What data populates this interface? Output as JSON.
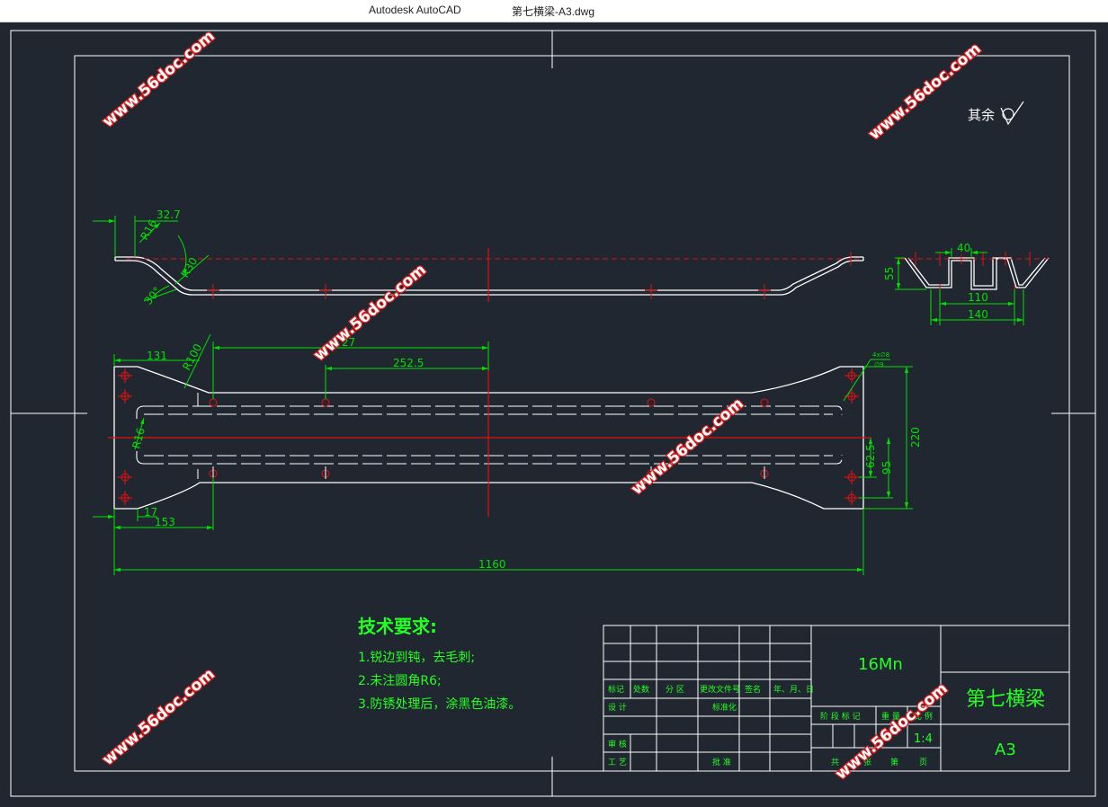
{
  "window": {
    "app_title": "Autodesk AutoCAD",
    "file_title": "第七横梁-A3.dwg"
  },
  "colors": {
    "background": "#212730",
    "drawing_lines": "#ffffff",
    "dimensions": "#00e000",
    "centerlines": "#e01010",
    "text": "#22ff22",
    "watermark": "#e02020"
  },
  "watermark": "www.56doc.com",
  "surface_note": "其余",
  "side_view_dims": {
    "d32_7": "32.7",
    "r16": "R16",
    "r30": "R30",
    "a30": "30°"
  },
  "section_view_dims": {
    "d40": "40",
    "d55": "55",
    "d110": "110",
    "d140": "140"
  },
  "plan_view_dims": {
    "d131": "131",
    "r100": "R100",
    "d27": "27",
    "d252_5": "252.5",
    "r16": "R16",
    "d17": "17",
    "d153": "153",
    "d1160": "1160",
    "d62_5": "62.5",
    "d95": "95",
    "d220": "220",
    "hole_note_a": "4x∅8",
    "hole_note_b": "∅9"
  },
  "tech_requirements": {
    "title": "技术要求:",
    "items": [
      "1.锐边到钝，去毛刺;",
      "2.未注圆角R6;",
      "3.防锈处理后，涂黑色油漆。"
    ]
  },
  "title_block": {
    "material": "16Mn",
    "part_name": "第七横梁",
    "sheet_size": "A3",
    "scale": "1:4",
    "labels": {
      "mark": "标记",
      "count": "处数",
      "zone": "分 区",
      "change_doc": "更改文件号",
      "signature": "签名",
      "date": "年、月、日",
      "design": "设 计",
      "standardization": "标准化",
      "review": "审 核",
      "process": "工 艺",
      "approve": "批 准",
      "stage_mark": "阶 段 标 记",
      "weight": "重 量",
      "ratio": "比 例",
      "total": "共",
      "sheets": "张",
      "page_no": "第",
      "page": "页"
    }
  }
}
